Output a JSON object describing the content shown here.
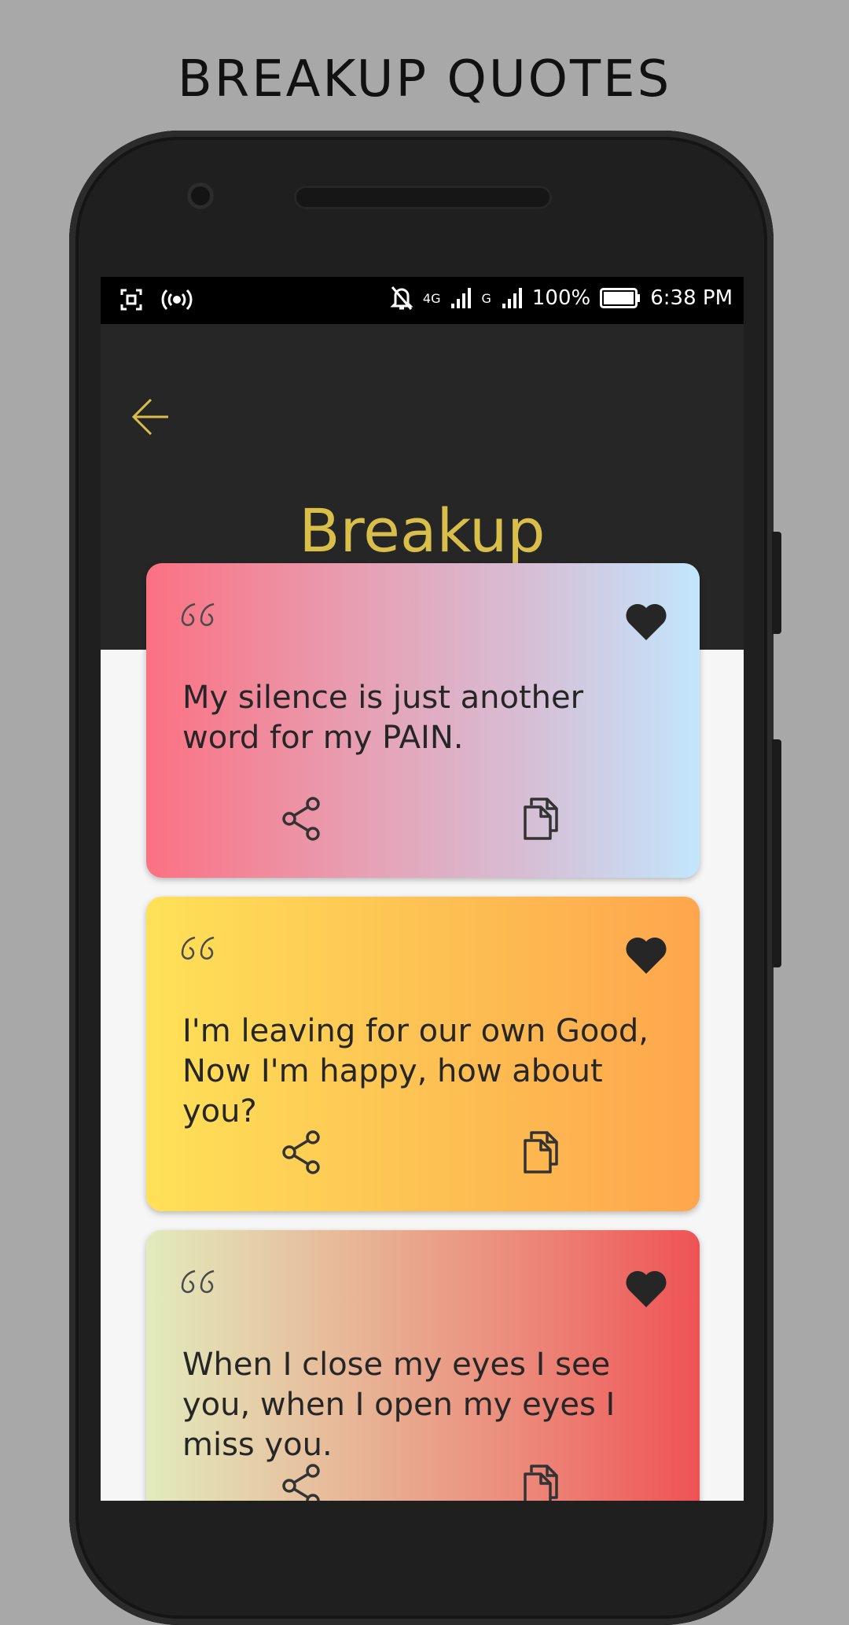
{
  "promo": {
    "title": "BREAKUP QUOTES"
  },
  "status_bar": {
    "network_4g": "4G",
    "network_g": "G",
    "battery": "100%",
    "time": "6:38 PM"
  },
  "header": {
    "back_icon": "arrow-left-icon",
    "title": "Breakup",
    "accent_color": "#d9bf4a",
    "background_color": "#262626"
  },
  "quotes": [
    {
      "text": "My silence is just another word for my PAIN.",
      "favorited": true
    },
    {
      "text": "I'm leaving for our own Good, Now I'm happy, how about you?",
      "favorited": true
    },
    {
      "text": "When I close my eyes I see you, when I open my eyes I miss you.",
      "favorited": true
    }
  ],
  "icons": {
    "quote": "quote-icon",
    "favorite": "heart-icon",
    "share": "share-icon",
    "copy": "copy-icon"
  }
}
